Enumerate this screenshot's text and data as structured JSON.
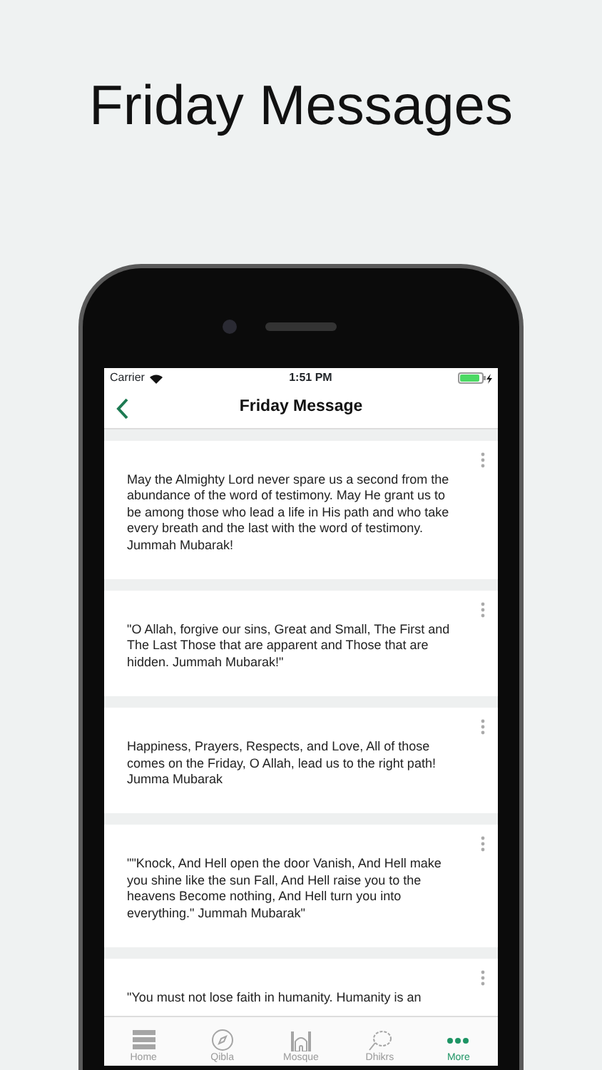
{
  "headline": "Friday Messages",
  "status_bar": {
    "carrier": "Carrier",
    "time": "1:51 PM"
  },
  "nav_bar": {
    "title": "Friday Message"
  },
  "messages": [
    {
      "text": "May the Almighty Lord never spare us a second from the abundance of the word of testimony. May He grant us to be among those who lead a life in His path and who take every breath and the last with the word of testimony. Jummah Mubarak!"
    },
    {
      "text": "\"O Allah, forgive our sins, Great and Small, The First and The Last Those that are apparent and Those that are hidden. Jummah Mubarak!\""
    },
    {
      "text": "Happiness, Prayers, Respects, and Love, All of those comes on the Friday, O Allah, lead us to the right path! Jumma Mubarak"
    },
    {
      "text": "\"\"Knock, And Hell open the door Vanish, And Hell make you shine like the sun Fall, And Hell raise you to the heavens Become nothing, And Hell turn you into everything.\" Jummah Mubarak\""
    },
    {
      "text": "\"You must not lose faith in humanity. Humanity is an"
    }
  ],
  "tab_bar": [
    {
      "label": "Home",
      "kind": "home",
      "selected": false
    },
    {
      "label": "Qibla",
      "kind": "qibla",
      "selected": false
    },
    {
      "label": "Mosque",
      "kind": "mosque",
      "selected": false
    },
    {
      "label": "Dhikrs",
      "kind": "dhikrs",
      "selected": false
    },
    {
      "label": "More",
      "kind": "more",
      "selected": true
    }
  ]
}
